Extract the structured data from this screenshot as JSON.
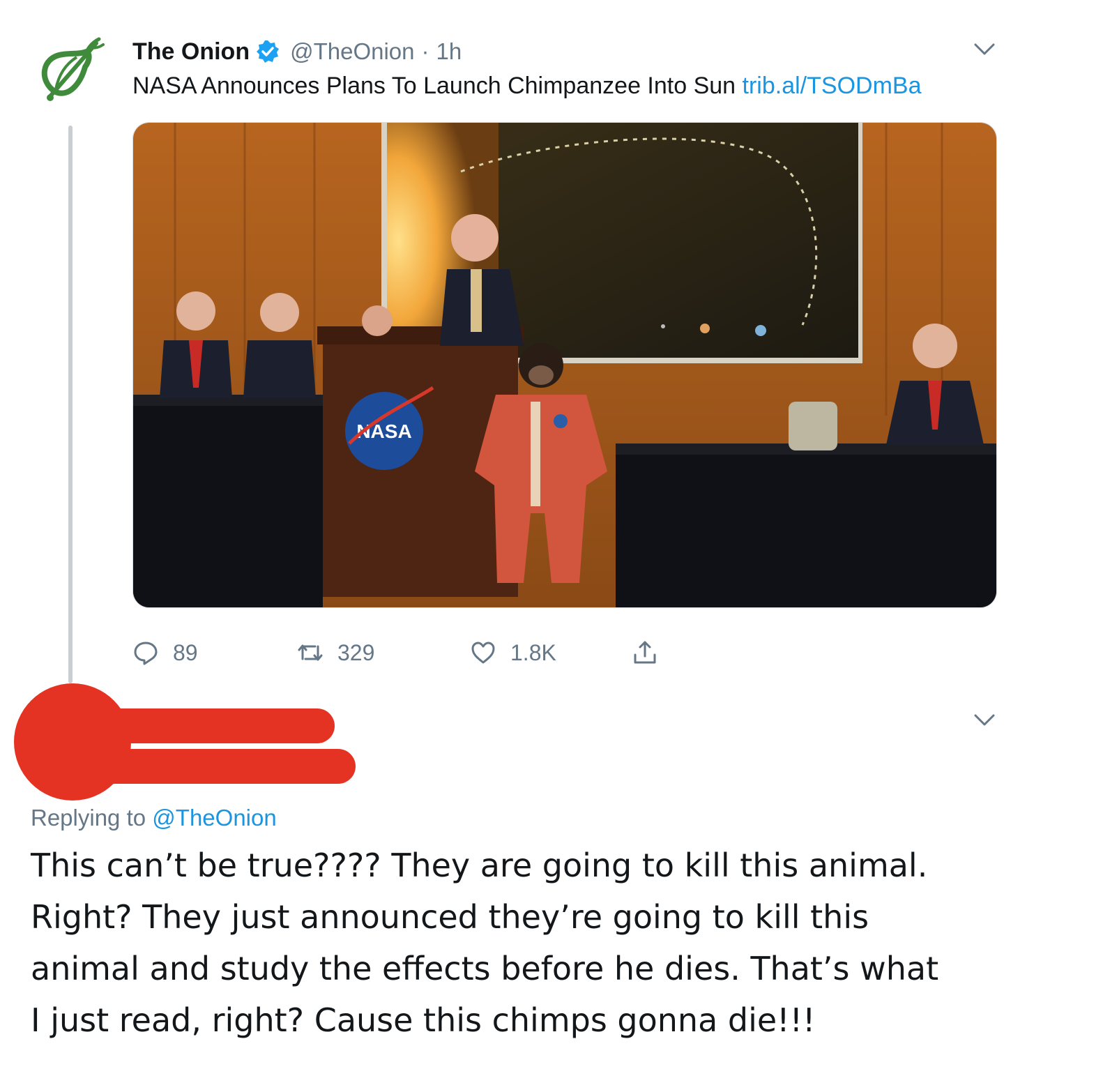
{
  "tweet": {
    "author": {
      "display_name": "The Onion",
      "handle": "@TheOnion",
      "verified": true,
      "avatar_icon": "onion-logo-icon"
    },
    "separator": "·",
    "timestamp": "1h",
    "text": "NASA Announces Plans To Launch Chimpanzee Into Sun",
    "link": "trib.al/TSODmBa",
    "media": {
      "podium_logo_text": "NASA"
    },
    "actions": {
      "replies": "89",
      "retweets": "329",
      "likes": "1.8K",
      "reply_icon": "reply-bubble-icon",
      "retweet_icon": "retweet-icon",
      "like_icon": "heart-icon",
      "share_icon": "share-icon"
    }
  },
  "reply": {
    "author_redacted": true,
    "replying_to_label": "Replying to",
    "replying_to_handle": "@TheOnion",
    "lines": [
      "This can’t be true???? They are going to kill this animal.",
      "Right? They just announced they’re going to kill this",
      "animal and study the effects before he dies. That’s what",
      "I just read, right? Cause this chimps gonna die!!!"
    ]
  },
  "colors": {
    "link": "#1b95e0",
    "secondary_text": "#657786",
    "verified": "#1da1f2",
    "onion_green": "#3f8a3b",
    "redaction": "#e53323"
  }
}
